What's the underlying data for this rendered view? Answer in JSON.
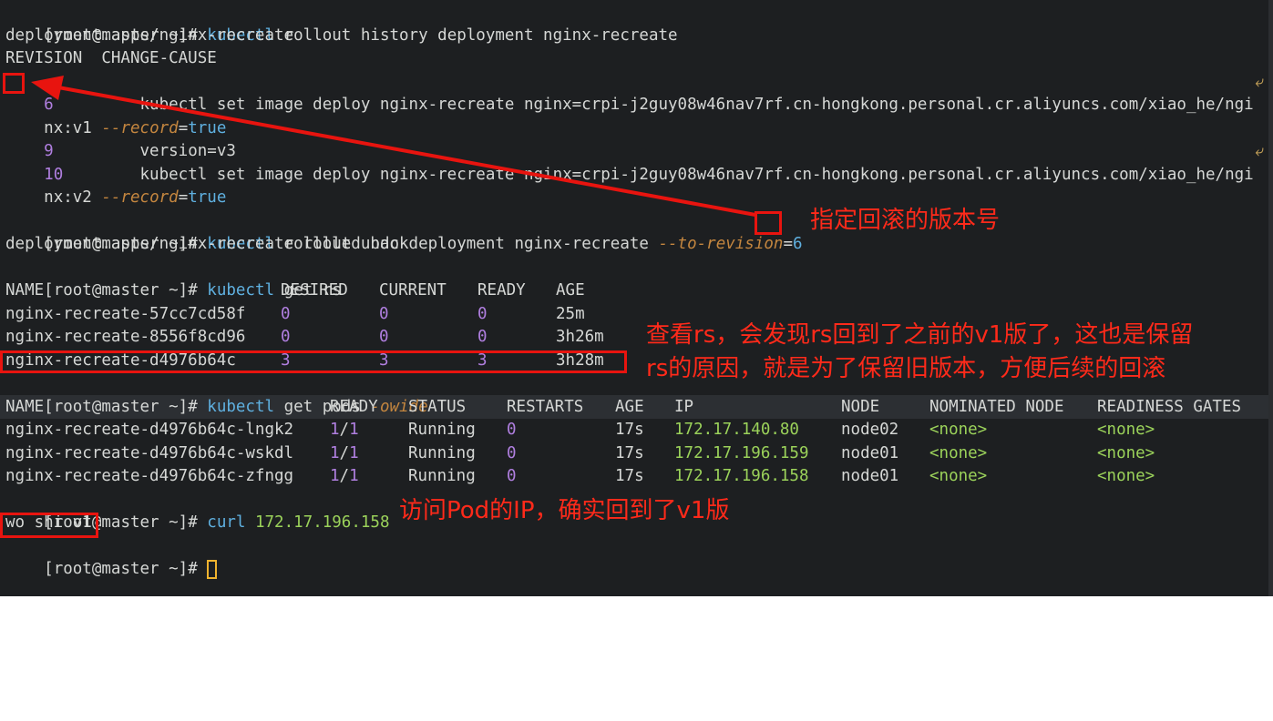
{
  "terminal": {
    "lines": [
      {
        "prompt": "[root@master ~]# ",
        "cmd": "kubectl",
        "rest": " rollout history deployment nginx-recreate"
      },
      {
        "text": "deployment.apps/nginx-recreate"
      },
      {
        "text": "REVISION  CHANGE-CAUSE"
      },
      {
        "num": "6",
        "body": "         kubectl set image deploy nginx-recreate nginx=crpi-j2guy08w46nav7rf.cn-hongkong.personal.cr.aliyuncs.com/xiao_he/ngi",
        "wrap": "⤶"
      },
      {
        "a": "nx",
        "b": ":v1 ",
        "c": "--record",
        "d": "=",
        "e": "true"
      },
      {
        "num": "9",
        "body": "         version=v3"
      },
      {
        "num": "10",
        "body": "        kubectl set image deploy nginx-recreate nginx=crpi-j2guy08w46nav7rf.cn-hongkong.personal.cr.aliyuncs.com/xiao_he/ngi",
        "wrap": "⤶"
      },
      {
        "a": "nx",
        "b": ":v2 ",
        "c": "--record",
        "d": "=",
        "e": "true"
      },
      {
        "text": ""
      },
      {
        "prompt": "[root@master ~]# ",
        "cmd": "kubectl",
        "rest": " rollout undo deployment nginx-recreate ",
        "flag": "--to-revision",
        "eq": "=",
        "val": "6"
      },
      {
        "text": "deployment.apps/nginx-recreate rolled back"
      },
      {
        "prompt": "[root@master ~]# ",
        "cmd": "kubectl",
        "rest": " get rs"
      },
      {
        "text": "NAME                                   DESIRED   CURRENT   READY   AGE"
      },
      {
        "row": "nginx-recreate-57cc7cd58f",
        "d": "0",
        "cu": "0",
        "r": "0",
        "age": "25m"
      },
      {
        "row": "nginx-recreate-8556f8cd96",
        "d": "0",
        "cu": "0",
        "r": "0",
        "age": "3h26m"
      },
      {
        "row": "nginx-recreate-d4976b64c",
        "d": "3",
        "cu": "3",
        "r": "3",
        "age": "3h28m"
      },
      {
        "prompt": "[root@master ~]# ",
        "cmd": "kubectl",
        "rest": " get pods ",
        "flag": "-owide"
      },
      {
        "text": "NAME                                   READY   STATUS    RESTARTS   AGE   IP               NODE     NOMINATED NODE   READINESS GATES"
      },
      {
        "pod": "nginx-recreate-d4976b64c-lngk2",
        "ready_a": "1",
        "ready_s": "/",
        "ready_b": "1",
        "status": "Running",
        "restarts": "0",
        "age": "17s",
        "ip": "172.17.140.80",
        "node": "node02",
        "nom": "<none>",
        "gates": "<none>"
      },
      {
        "pod": "nginx-recreate-d4976b64c-wskdl",
        "ready_a": "1",
        "ready_s": "/",
        "ready_b": "1",
        "status": "Running",
        "restarts": "0",
        "age": "17s",
        "ip": "172.17.196.159",
        "node": "node01",
        "nom": "<none>",
        "gates": "<none>"
      },
      {
        "pod": "nginx-recreate-d4976b64c-zfngg",
        "ready_a": "1",
        "ready_s": "/",
        "ready_b": "1",
        "status": "Running",
        "restarts": "0",
        "age": "17s",
        "ip": "172.17.196.158",
        "node": "node01",
        "nom": "<none>",
        "gates": "<none>"
      },
      {
        "prompt": "[root@master ~]# ",
        "cmd": "curl",
        "ip": " 172.17.196.158"
      },
      {
        "text": "wo shi v1"
      },
      {
        "prompt": "[root@master ~]# "
      }
    ]
  },
  "annotations": {
    "revision_note": "指定回滚的版本号",
    "rs_note_line1": "查看rs，会发现rs回到了之前的v1版了，这也是保留",
    "rs_note_line2": "rs的原因，就是为了保留旧版本，方便后续的回滚",
    "pod_note": "访问Pod的IP，确实回到了v1版"
  },
  "colors": {
    "background": "#1d1f21",
    "foreground": "#d5d7d5",
    "command": "#5fb0e0",
    "number": "#b07fe0",
    "ip": "#9bd25a",
    "flag": "#c4863f",
    "annotation": "#ff2a1a"
  }
}
